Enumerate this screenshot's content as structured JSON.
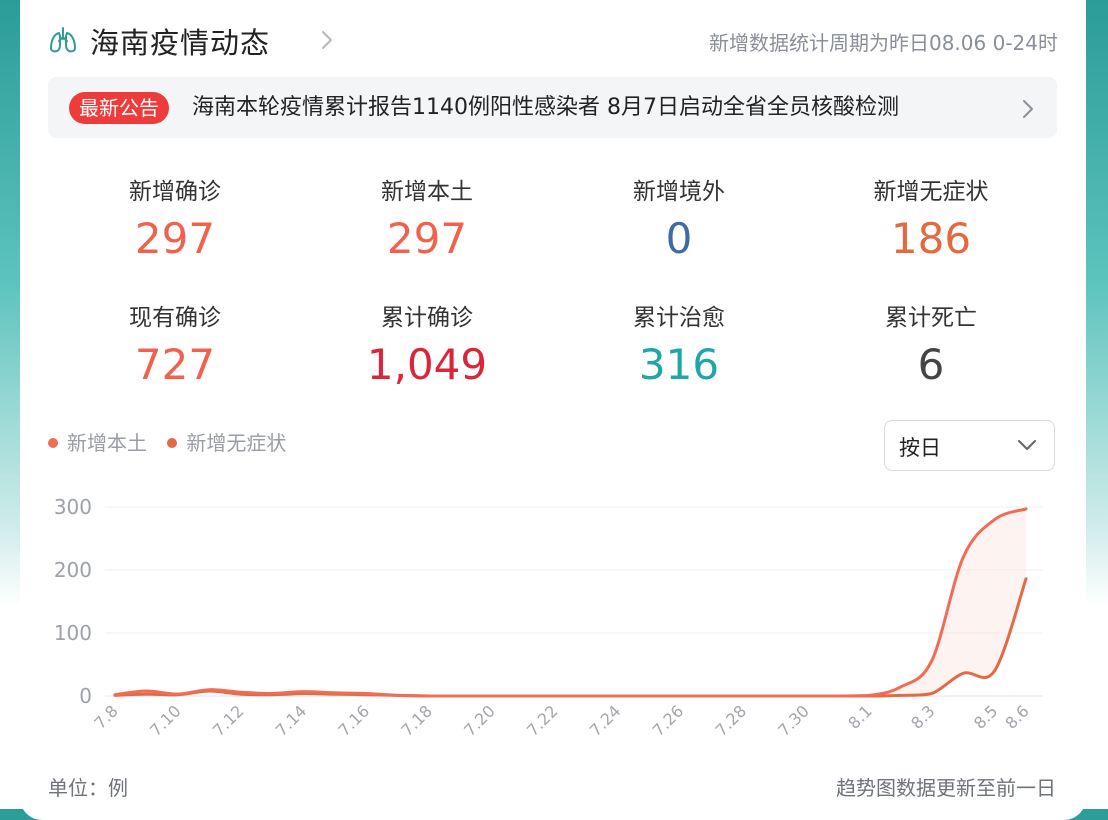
{
  "header": {
    "title": "海南疫情动态",
    "period": "新增数据统计周期为昨日08.06 0-24时",
    "icon": "lungs-icon"
  },
  "notice": {
    "badge": "最新公告",
    "text": "海南本轮疫情累计报告1140例阳性感染者 8月7日启动全省全员核酸检测"
  },
  "stats": [
    {
      "label": "新增确诊",
      "value": "297",
      "color": "#f0624d"
    },
    {
      "label": "新增本土",
      "value": "297",
      "color": "#f0624d"
    },
    {
      "label": "新增境外",
      "value": "0",
      "color": "#3f6aa8"
    },
    {
      "label": "新增无症状",
      "value": "186",
      "color": "#e3693f"
    },
    {
      "label": "现有确诊",
      "value": "727",
      "color": "#f0624d"
    },
    {
      "label": "累计确诊",
      "value": "1,049",
      "color": "#d9263a"
    },
    {
      "label": "累计治愈",
      "value": "316",
      "color": "#1fa7a6"
    },
    {
      "label": "累计死亡",
      "value": "6",
      "color": "#444444"
    }
  ],
  "dropdown": {
    "selected": "按日"
  },
  "footer": {
    "unit": "单位：例",
    "note": "趋势图数据更新至前一日"
  },
  "chart_data": {
    "type": "line",
    "x": [
      "7.8",
      "7.9",
      "7.10",
      "7.11",
      "7.12",
      "7.13",
      "7.14",
      "7.15",
      "7.16",
      "7.17",
      "7.18",
      "7.19",
      "7.20",
      "7.21",
      "7.22",
      "7.23",
      "7.24",
      "7.25",
      "7.26",
      "7.27",
      "7.28",
      "7.29",
      "7.30",
      "7.31",
      "8.1",
      "8.2",
      "8.3",
      "8.4",
      "8.5",
      "8.6"
    ],
    "x_tick_labels": [
      "7.8",
      "7.10",
      "7.12",
      "7.14",
      "7.16",
      "7.18",
      "7.20",
      "7.22",
      "7.24",
      "7.26",
      "7.28",
      "7.30",
      "8.1",
      "8.3",
      "8.5",
      "8.6"
    ],
    "series": [
      {
        "name": "新增本土",
        "color": "#f26b55",
        "values": [
          2,
          8,
          3,
          10,
          6,
          4,
          7,
          5,
          4,
          1,
          0,
          0,
          0,
          0,
          0,
          0,
          0,
          0,
          0,
          0,
          0,
          0,
          0,
          0,
          1,
          14,
          56,
          220,
          280,
          297
        ]
      },
      {
        "name": "新增无症状",
        "color": "#e36a42",
        "values": [
          1,
          3,
          2,
          8,
          3,
          2,
          4,
          3,
          2,
          1,
          0,
          0,
          0,
          0,
          0,
          0,
          0,
          0,
          0,
          0,
          0,
          0,
          0,
          0,
          0,
          1,
          4,
          36,
          40,
          186
        ]
      }
    ],
    "y_ticks": [
      0,
      100,
      200,
      300
    ],
    "ylim": [
      0,
      300
    ],
    "legend": "top-left",
    "grid": true
  }
}
